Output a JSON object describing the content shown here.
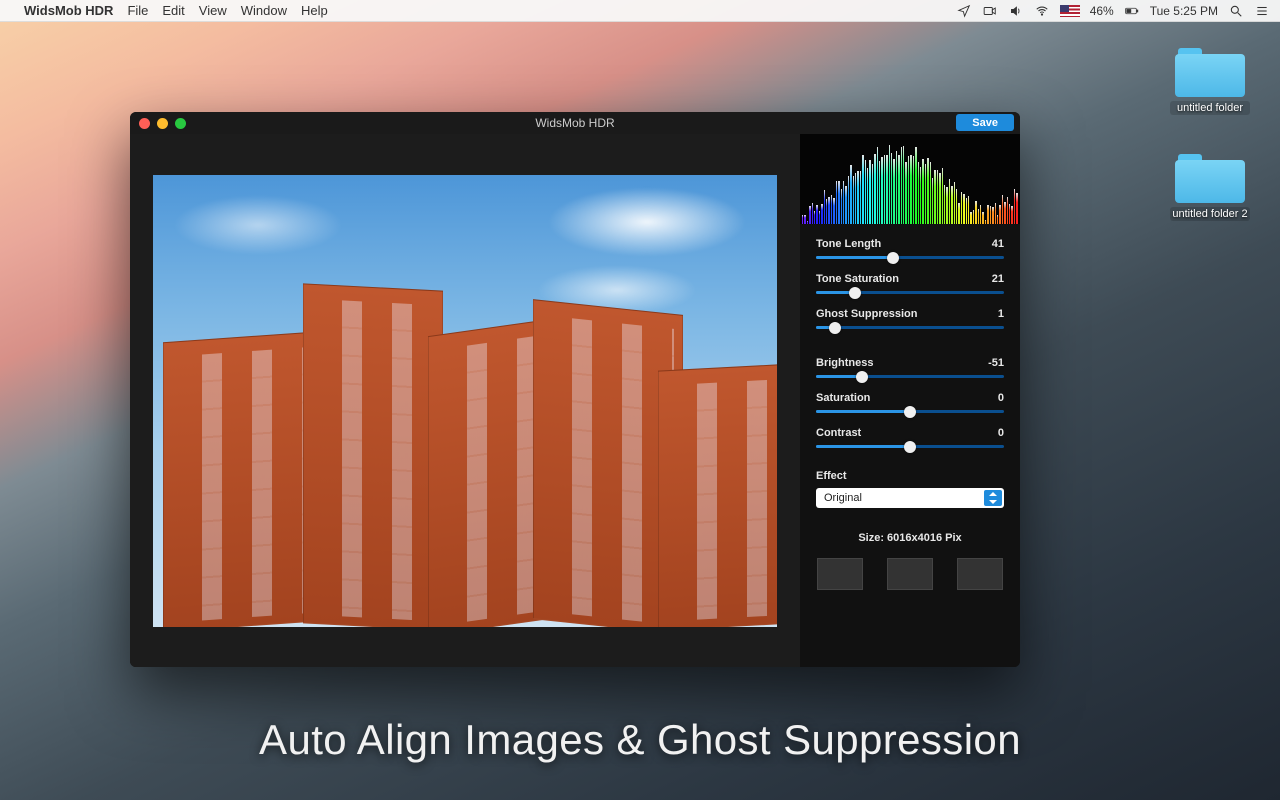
{
  "menubar": {
    "app_name": "WidsMob HDR",
    "items": [
      "File",
      "Edit",
      "View",
      "Window",
      "Help"
    ],
    "status": {
      "battery": "46%",
      "clock": "Tue 5:25 PM"
    }
  },
  "desktop": {
    "folders": [
      "untitled folder",
      "untitled folder 2"
    ]
  },
  "window": {
    "title": "WidsMob HDR",
    "save_label": "Save"
  },
  "sliders": {
    "tone_length": {
      "label": "Tone Length",
      "value": 41,
      "min": 0,
      "max": 100
    },
    "tone_saturation": {
      "label": "Tone Saturation",
      "value": 21,
      "min": 0,
      "max": 100
    },
    "ghost_suppression": {
      "label": "Ghost Suppression",
      "value": 1,
      "min": 0,
      "max": 10
    },
    "brightness": {
      "label": "Brightness",
      "value": -51,
      "min": -100,
      "max": 100
    },
    "saturation": {
      "label": "Saturation",
      "value": 0,
      "min": -100,
      "max": 100
    },
    "contrast": {
      "label": "Contrast",
      "value": 0,
      "min": -100,
      "max": 100
    }
  },
  "effect": {
    "label": "Effect",
    "selected": "Original"
  },
  "size_line": "Size: 6016x4016 Pix",
  "caption": "Auto Align Images & Ghost Suppression"
}
